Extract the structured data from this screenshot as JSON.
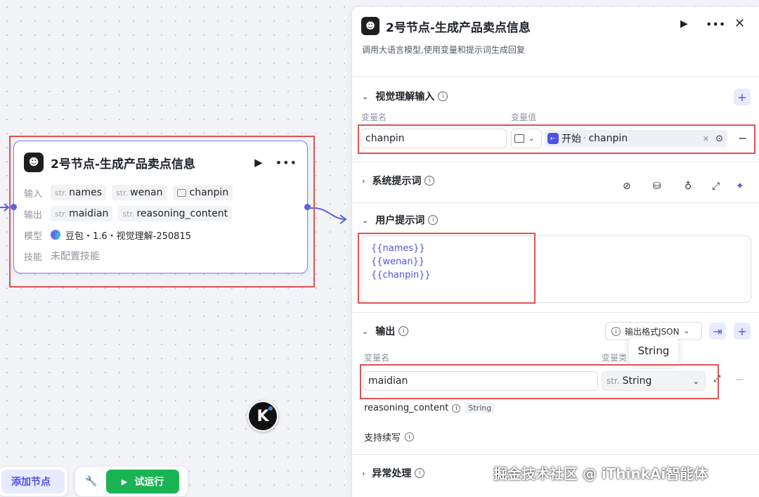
{
  "canvas": {
    "node": {
      "title": "2号节点-生成产品卖点信息",
      "input_label": "输入",
      "inputs": [
        {
          "type": "str.",
          "name": "names"
        },
        {
          "type": "str.",
          "name": "wenan"
        },
        {
          "type": "image",
          "name": "chanpin"
        }
      ],
      "output_label": "输出",
      "outputs": [
        {
          "type": "str.",
          "name": "maidian"
        },
        {
          "type": "str.",
          "name": "reasoning_content"
        }
      ],
      "model_label": "模型",
      "model_value": "豆包・1.6・视觉理解-250815",
      "skill_label": "技能",
      "skill_value": "未配置技能"
    },
    "badge_letter": "K",
    "add_node_label": "添加节点",
    "test_run_label": "试运行"
  },
  "panel": {
    "title": "2号节点-生成产品卖点信息",
    "subtitle": "调用大语言模型,使用变量和提示词生成回复",
    "visual_input": {
      "title": "视觉理解输入",
      "col_name": "变量名",
      "col_value": "变量值",
      "var_name": "chanpin",
      "ref_source": "开始",
      "ref_var": "chanpin"
    },
    "system_prompt": {
      "title": "系统提示词"
    },
    "user_prompt": {
      "title": "用户提示词",
      "lines": [
        "{{names}}",
        "{{wenan}}",
        "{{chanpin}}"
      ]
    },
    "output": {
      "title": "输出",
      "format_label": "输出格式JSON",
      "col_name": "变量名",
      "col_type": "变量类",
      "tooltip": "String",
      "var_name": "maidian",
      "var_type_prefix": "str.",
      "var_type": "String",
      "extra_var": "reasoning_content",
      "extra_type": "String",
      "continue_label": "支持续写"
    },
    "error_handling": {
      "title": "异常处理"
    }
  },
  "watermark": "掘金技术社区 @ iThinkAi智能体",
  "colors": {
    "accent": "#4d53e8",
    "run_green": "#1ab454",
    "highlight_red": "#e05252"
  }
}
